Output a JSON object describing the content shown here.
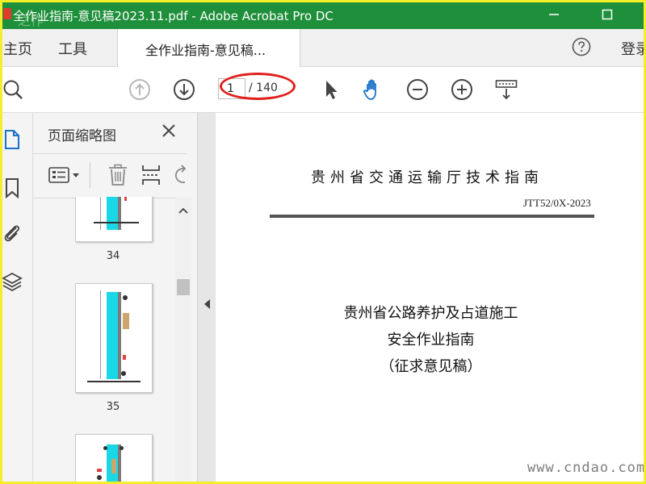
{
  "window": {
    "title": "全作业指南-意见稿2023.11.pdf - Adobe Acrobat Pro DC",
    "overlay_watermark": "之作"
  },
  "menubar": {
    "home": "主页",
    "tools": "工具",
    "doc_tab": "全作业指南-意见稿...",
    "login": "登录"
  },
  "toolbar": {
    "page_current": "1",
    "page_total": "/ 140"
  },
  "thumbnails_panel": {
    "title": "页面缩略图",
    "pages": [
      {
        "label": "34"
      },
      {
        "label": "35"
      },
      {
        "label": ""
      }
    ]
  },
  "document": {
    "header": "贵州省交通运输厅技术指南",
    "code": "JTT52/0X-2023",
    "title_line1": "贵州省公路养护及占道施工",
    "title_line2": "安全作业指南",
    "title_line3": "（征求意见稿）"
  },
  "watermark": "www.cndao.com",
  "colors": {
    "titlebar": "#1e8f3a",
    "accent_blue": "#1a73c8",
    "annotation_red": "#e0201c",
    "frame_yellow": "#f4ee2a",
    "thumb_cyan": "#1ad7e6"
  }
}
